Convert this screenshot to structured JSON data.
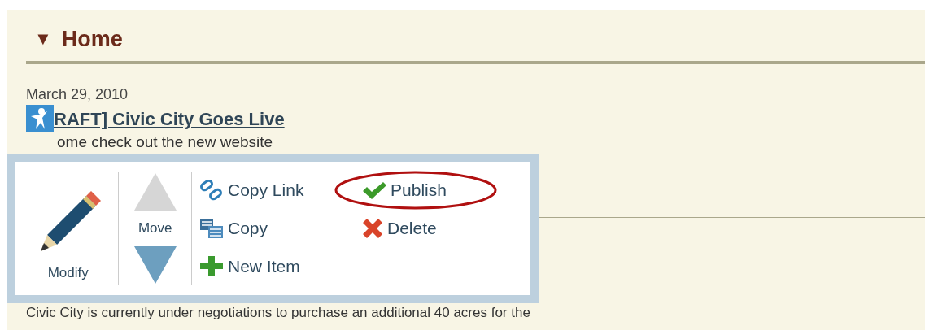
{
  "section": {
    "toggle": "▼",
    "title": "Home",
    "expanded": true
  },
  "post": {
    "date": "March 29, 2010",
    "title": "RAFT] Civic City Goes Live",
    "summary": "ome check out the new website"
  },
  "toolbar": {
    "modify": "Modify",
    "move": "Move",
    "actions": [
      {
        "label": "Copy Link",
        "kind": "link",
        "circled": false
      },
      {
        "label": "Publish",
        "kind": "publish",
        "circled": true
      },
      {
        "label": "Copy",
        "kind": "copy",
        "circled": false
      },
      {
        "label": "Delete",
        "kind": "delete",
        "circled": false
      },
      {
        "label": "New Item",
        "kind": "new",
        "circled": false
      }
    ]
  },
  "body": "Civic City is currently under negotiations to purchase an additional 40 acres for the"
}
